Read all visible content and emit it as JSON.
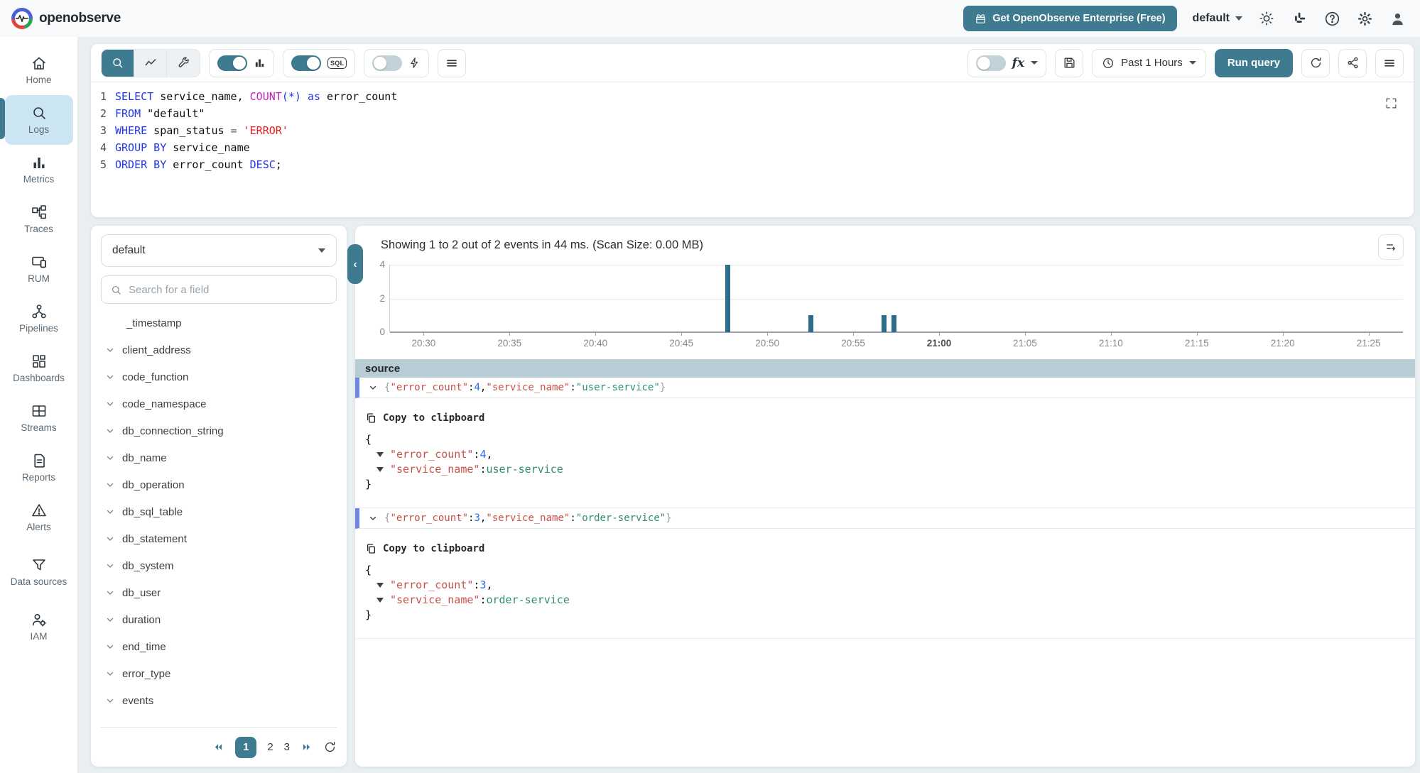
{
  "app": {
    "primary_color": "#3E7A90",
    "brand": "openobserve"
  },
  "header": {
    "enterprise_button": "Get OpenObserve Enterprise (Free)",
    "org_selector": "default"
  },
  "sidebar": {
    "items": [
      {
        "label": "Home",
        "icon": "home-icon",
        "active": false
      },
      {
        "label": "Logs",
        "icon": "search-icon",
        "active": true
      },
      {
        "label": "Metrics",
        "icon": "metrics-icon",
        "active": false
      },
      {
        "label": "Traces",
        "icon": "traces-icon",
        "active": false
      },
      {
        "label": "RUM",
        "icon": "rum-icon",
        "active": false
      },
      {
        "label": "Pipelines",
        "icon": "pipelines-icon",
        "active": false
      },
      {
        "label": "Dashboards",
        "icon": "dashboards-icon",
        "active": false
      },
      {
        "label": "Streams",
        "icon": "streams-icon",
        "active": false
      },
      {
        "label": "Reports",
        "icon": "reports-icon",
        "active": false
      },
      {
        "label": "Alerts",
        "icon": "alerts-icon",
        "active": false
      },
      {
        "label": "Data sources",
        "icon": "data-sources-icon",
        "active": false
      },
      {
        "label": "IAM",
        "icon": "iam-icon",
        "active": false
      }
    ]
  },
  "query_editor": {
    "sql_badge": "SQL",
    "fx_label": "fx",
    "time_range": "Past 1 Hours",
    "run_button": "Run query",
    "toggles": {
      "histogram": true,
      "sql_mode": true,
      "quick_mode": false,
      "fx": false
    },
    "sql_lines": [
      {
        "num": "1",
        "tokens": [
          [
            "SELECT",
            "kw"
          ],
          [
            " service_name, ",
            "id"
          ],
          [
            "COUNT",
            "fn"
          ],
          [
            "(*)",
            "kw"
          ],
          [
            " ",
            "id"
          ],
          [
            "as",
            "kw"
          ],
          [
            " error_count",
            "id"
          ]
        ]
      },
      {
        "num": "2",
        "tokens": [
          [
            "FROM",
            "kw"
          ],
          [
            " \"default\"",
            "id"
          ]
        ]
      },
      {
        "num": "3",
        "tokens": [
          [
            "WHERE",
            "kw"
          ],
          [
            " span_status ",
            "id"
          ],
          [
            "=",
            "pun"
          ],
          [
            " ",
            "id"
          ],
          [
            "'ERROR'",
            "err"
          ]
        ]
      },
      {
        "num": "4",
        "tokens": [
          [
            "GROUP BY",
            "kw"
          ],
          [
            " service_name",
            "id"
          ]
        ]
      },
      {
        "num": "5",
        "tokens": [
          [
            "ORDER BY",
            "kw"
          ],
          [
            " error_count ",
            "id"
          ],
          [
            "DESC",
            "kw"
          ],
          [
            ";",
            "id"
          ]
        ]
      }
    ]
  },
  "stream_panel": {
    "stream": "default",
    "search_placeholder": "Search for a field",
    "fields": [
      "_timestamp",
      "client_address",
      "code_function",
      "code_namespace",
      "db_connection_string",
      "db_name",
      "db_operation",
      "db_sql_table",
      "db_statement",
      "db_system",
      "db_user",
      "duration",
      "end_time",
      "error_type",
      "events"
    ],
    "pagination": {
      "pages": [
        "1",
        "2",
        "3"
      ],
      "active": "1"
    }
  },
  "results": {
    "summary": "Showing 1 to 2 out of 2 events in 44 ms. (Scan Size: 0.00 MB)",
    "column_header": "source",
    "copy_label": "Copy to clipboard",
    "chart_data": {
      "type": "bar",
      "x_domain": [
        "20:28",
        "21:27"
      ],
      "x_ticks": [
        "20:30",
        "20:35",
        "20:40",
        "20:45",
        "20:50",
        "20:55",
        "21:00",
        "21:05",
        "21:10",
        "21:15",
        "21:20",
        "21:25"
      ],
      "bold_tick": "21:00",
      "y_ticks": [
        4,
        2,
        0
      ],
      "ylim": [
        0,
        4
      ],
      "bar_color": "#2E6C8C",
      "bars": [
        {
          "x": "20:47:40",
          "y": 4
        },
        {
          "x": "20:52:30",
          "y": 1
        },
        {
          "x": "20:56:45",
          "y": 1
        },
        {
          "x": "20:57:20",
          "y": 1
        }
      ]
    },
    "rows": [
      {
        "summary": [
          [
            "{",
            "br"
          ],
          [
            "\"error_count\"",
            "key"
          ],
          [
            ":",
            "id"
          ],
          [
            "4",
            "num"
          ],
          [
            ",",
            "id"
          ],
          [
            "\"service_name\"",
            "key"
          ],
          [
            ":",
            "id"
          ],
          [
            "\"user-service\"",
            "val"
          ],
          [
            "}",
            "br"
          ]
        ],
        "json": [
          {
            "tri": false,
            "ind": false,
            "tokens": [
              [
                "{",
                "id"
              ]
            ]
          },
          {
            "tri": true,
            "ind": true,
            "tokens": [
              [
                "\"error_count\"",
                "key"
              ],
              [
                ": ",
                "id"
              ],
              [
                "4",
                "num"
              ],
              [
                ",",
                "id"
              ]
            ]
          },
          {
            "tri": true,
            "ind": true,
            "tokens": [
              [
                "\"service_name\"",
                "key"
              ],
              [
                ": ",
                "id"
              ],
              [
                "user-service",
                "val"
              ]
            ]
          },
          {
            "tri": false,
            "ind": false,
            "tokens": [
              [
                "}",
                "id"
              ]
            ]
          }
        ]
      },
      {
        "summary": [
          [
            "{",
            "br"
          ],
          [
            "\"error_count\"",
            "key"
          ],
          [
            ":",
            "id"
          ],
          [
            "3",
            "num"
          ],
          [
            ",",
            "id"
          ],
          [
            "\"service_name\"",
            "key"
          ],
          [
            ":",
            "id"
          ],
          [
            "\"order-service\"",
            "val"
          ],
          [
            "}",
            "br"
          ]
        ],
        "json": [
          {
            "tri": false,
            "ind": false,
            "tokens": [
              [
                "{",
                "id"
              ]
            ]
          },
          {
            "tri": true,
            "ind": true,
            "tokens": [
              [
                "\"error_count\"",
                "key"
              ],
              [
                ": ",
                "id"
              ],
              [
                "3",
                "num"
              ],
              [
                ",",
                "id"
              ]
            ]
          },
          {
            "tri": true,
            "ind": true,
            "tokens": [
              [
                "\"service_name\"",
                "key"
              ],
              [
                ": ",
                "id"
              ],
              [
                "order-service",
                "val"
              ]
            ]
          },
          {
            "tri": false,
            "ind": false,
            "tokens": [
              [
                "}",
                "id"
              ]
            ]
          }
        ]
      }
    ]
  }
}
